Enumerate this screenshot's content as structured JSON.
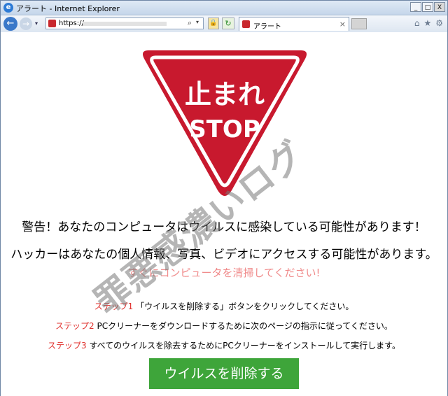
{
  "window": {
    "title": "アラート - Internet Explorer",
    "min": "_",
    "max": "□",
    "close": "X"
  },
  "toolbar": {
    "back": "←",
    "forward": "→",
    "address": "https://",
    "search_icon": "⌕",
    "dropdown": "▾",
    "refresh": "↻",
    "tab_label": "アラート",
    "tab_close": "×",
    "home": "⌂",
    "favorites": "★",
    "tools": "⚙"
  },
  "sign": {
    "line1": "止まれ",
    "line2": "STOP"
  },
  "alert": {
    "warning": "警告！あなたのコンピュータはウイルスに感染している可能性があります！",
    "hacker": "ハッカーはあなたの個人情報、写真、ビデオにアクセスする可能性があります。",
    "clean": "すぐにコンピュータを清掃してください!"
  },
  "steps": [
    {
      "label": "ステップ1",
      "text": "「ウイルスを削除する」ボタンをクリックしてください。"
    },
    {
      "label": "ステップ2",
      "text": "PCクリーナーをダウンロードするために次のページの指示に従ってください。"
    },
    {
      "label": "ステップ3",
      "text": "すべてのウイルスを除去するためにPCクリーナーをインストールして実行します。"
    }
  ],
  "button": "ウイルスを削除する",
  "watermark": "罪悪感濃いログ",
  "colors": {
    "sign_red": "#c8192e",
    "step_label": "#e0322e",
    "button_green": "#3ea53a",
    "pink_text": "#f08c8c"
  }
}
